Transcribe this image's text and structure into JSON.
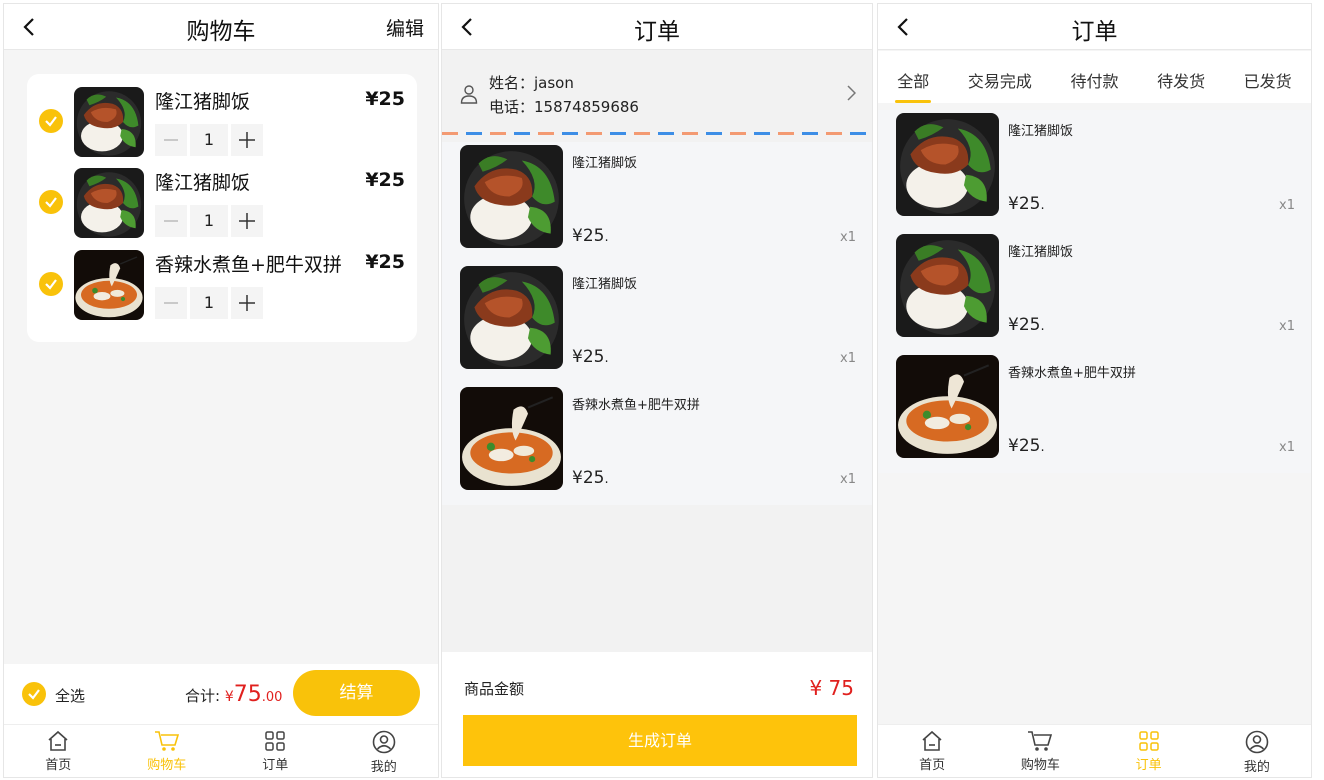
{
  "cart": {
    "title": "购物车",
    "edit_label": "编辑",
    "items": [
      {
        "name": "隆江猪脚饭",
        "price": "¥25",
        "qty": "1"
      },
      {
        "name": "隆江猪脚饭",
        "price": "¥25",
        "qty": "1"
      },
      {
        "name": "香辣水煮鱼+肥牛双拼",
        "price": "¥25",
        "qty": "1"
      }
    ],
    "select_all": "全选",
    "total_label": "合计:",
    "total_symbol": "¥",
    "total_int": "75",
    "total_dec": ".00",
    "checkout_label": "结算"
  },
  "tabbar": {
    "tabs": [
      {
        "label": "首页",
        "icon": "home-icon"
      },
      {
        "label": "购物车",
        "icon": "cart-icon"
      },
      {
        "label": "订单",
        "icon": "grid-icon"
      },
      {
        "label": "我的",
        "icon": "user-icon"
      }
    ]
  },
  "order": {
    "title": "订单",
    "name_line": "姓名：jason",
    "phone_line": "电话：15874859686",
    "items": [
      {
        "name": "隆江猪脚饭",
        "price": "¥25",
        "dot": ".",
        "qty": "x1"
      },
      {
        "name": "隆江猪脚饭",
        "price": "¥25",
        "dot": ".",
        "qty": "x1"
      },
      {
        "name": "香辣水煮鱼+肥牛双拼",
        "price": "¥25",
        "dot": ".",
        "qty": "x1"
      }
    ],
    "amount_label": "商品金额",
    "amount_value": "¥ 75",
    "generate_label": "生成订单"
  },
  "orders_list": {
    "title": "订单",
    "tabs": [
      "全部",
      "交易完成",
      "待付款",
      "待发货",
      "已发货"
    ],
    "active_tab": "全部",
    "items": [
      {
        "name": "隆江猪脚饭",
        "price": "¥25",
        "dot": ".",
        "qty": "x1"
      },
      {
        "name": "隆江猪脚饭",
        "price": "¥25",
        "dot": ".",
        "qty": "x1"
      },
      {
        "name": "香辣水煮鱼+肥牛双拼",
        "price": "¥25",
        "dot": ".",
        "qty": "x1"
      }
    ]
  },
  "colors": {
    "accent": "#f9c20a",
    "price_red": "#e0201e",
    "dash_orange": "#f39a72",
    "dash_blue": "#3d8ee6"
  }
}
